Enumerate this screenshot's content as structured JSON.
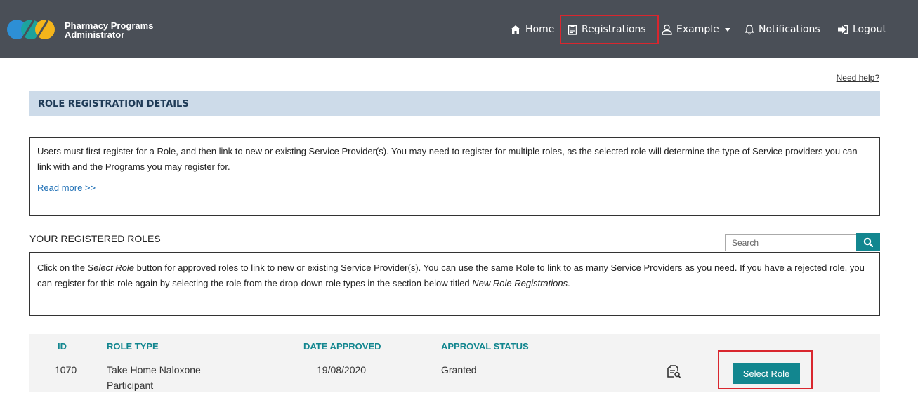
{
  "brand": {
    "line1": "Pharmacy Programs",
    "line2": "Administrator"
  },
  "nav": {
    "home": "Home",
    "registrations": "Registrations",
    "user": "Example",
    "notifications": "Notifications",
    "logout": "Logout",
    "icons": [
      "home-icon",
      "clipboard-icon",
      "user-icon",
      "caret-down-icon",
      "bell-icon",
      "logout-icon"
    ]
  },
  "help_link": "Need help?",
  "section_title": "ROLE REGISTRATION DETAILS",
  "intro": {
    "text": "Users must first register for a Role, and then link to new or existing Service Provider(s). You may need to register for multiple roles, as the selected role will determine the type of Service providers you can link with and the Programs you may register for.",
    "read_more": "Read more >>"
  },
  "registered_roles": {
    "title": "YOUR REGISTERED ROLES",
    "search_placeholder": "Search",
    "info_part1": "Click on the ",
    "info_em1": "Select Role",
    "info_part2": " button for approved roles to link to new or existing Service Provider(s). You can use the same Role to link to as many Service Providers as you need. If you have a rejected role, you can register for this role again by selecting the role from the drop-down role types in the section below titled ",
    "info_em2": "New Role Registrations",
    "info_part3": "."
  },
  "table": {
    "headers": {
      "id": "ID",
      "role_type": "ROLE TYPE",
      "date_approved": "DATE APPROVED",
      "approval_status": "APPROVAL STATUS"
    },
    "rows": [
      {
        "id": "1070",
        "role_type_line1": "Take Home Naloxone",
        "role_type_line2": "Participant",
        "date_approved": "19/08/2020",
        "approval_status": "Granted",
        "action": "Select Role"
      }
    ]
  },
  "colors": {
    "topbar": "#4a4f57",
    "accent": "#12868f",
    "highlight": "#d9262e",
    "section_bg": "#cddbe9"
  }
}
